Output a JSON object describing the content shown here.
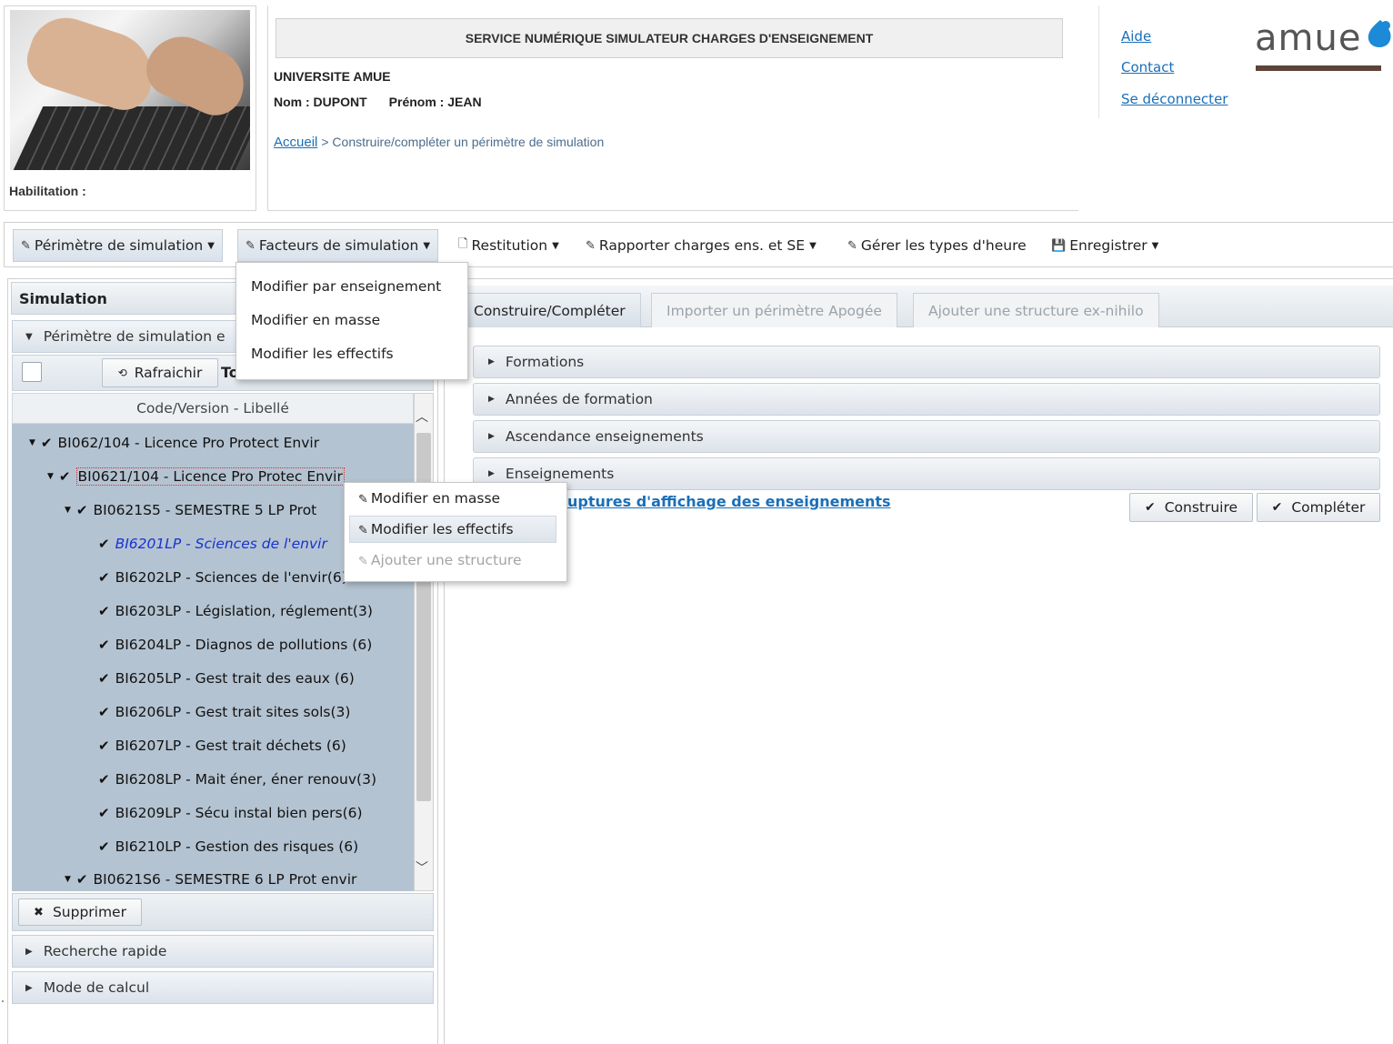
{
  "header": {
    "habilitation_label": "Habilitation :",
    "app_title": "SERVICE NUMÉRIQUE SIMULATEUR CHARGES D'ENSEIGNEMENT",
    "university": "UNIVERSITE AMUE",
    "nom": "Nom : DUPONT",
    "prenom": "Prénom : JEAN",
    "breadcrumb_home": "Accueil",
    "breadcrumb_current": "> Construire/compléter un périmètre de simulation",
    "links": {
      "aide": "Aide",
      "contact": "Contact",
      "deconnexion": "Se déconnecter"
    },
    "logo_text": "amue",
    "logo_color": "#1c8ad6"
  },
  "menubar": {
    "items": [
      {
        "label": "Périmètre de simulation",
        "icon": "pencil-icon"
      },
      {
        "label": "Facteurs de simulation",
        "icon": "pencil-icon"
      },
      {
        "label": "Restitution",
        "icon": "document-icon"
      },
      {
        "label": "Rapporter charges ens. et SE",
        "icon": "pencil-icon"
      },
      {
        "label": "Gérer les types d'heure",
        "icon": "pencil-icon"
      },
      {
        "label": "Enregistrer",
        "icon": "save-icon"
      }
    ]
  },
  "facteurs_dropdown": {
    "items": [
      "Modifier par enseignement",
      "Modifier en masse",
      "Modifier les effectifs"
    ]
  },
  "left_panel": {
    "title": "Simulation",
    "perimetre_header": "Périmètre de simulation e",
    "refresh_label": "Rafraichir",
    "tout_label": "To",
    "tree_column_header": "Code/Version - Libellé",
    "tree": [
      {
        "label": "BI062/104 - Licence Pro Protect Envir",
        "level": 0,
        "expandable": true
      },
      {
        "label": "BI0621/104 - Licence Pro Protec Envir",
        "level": 1,
        "expandable": true,
        "selected": true
      },
      {
        "label": "BI0621S5 - SEMESTRE 5 LP Prot",
        "level": 2,
        "expandable": true
      },
      {
        "label": "BI6201LP - Sciences de l'envir",
        "level": 3,
        "highlight": true
      },
      {
        "label": "BI6202LP - Sciences de l'envir",
        "level": 3
      },
      {
        "label": "BI6203LP - Législation, réglement(3)",
        "level": 3
      },
      {
        "label": "BI6204LP - Diagnos de pollutions (6)",
        "level": 3
      },
      {
        "label": "BI6205LP - Gest trait des eaux (6)",
        "level": 3
      },
      {
        "label": "BI6206LP - Gest trait sites sols(3)",
        "level": 3
      },
      {
        "label": "BI6207LP - Gest trait déchets (6)",
        "level": 3
      },
      {
        "label": "BI6208LP - Mait éner, éner renouv(3)",
        "level": 3
      },
      {
        "label": "BI6209LP - Sécu instal bien pers(6)",
        "level": 3
      },
      {
        "label": "BI6210LP - Gestion des risques (6)",
        "level": 3
      },
      {
        "label": "BI0621S6 - SEMESTRE 6 LP Prot envir",
        "level": 2,
        "expandable": true
      }
    ],
    "delete_label": "Supprimer",
    "recherche_label": "Recherche rapide",
    "mode_label": "Mode de calcul"
  },
  "context_menu": {
    "items": [
      {
        "label": "Modifier en masse",
        "enabled": true
      },
      {
        "label": "Modifier les effectifs",
        "enabled": true,
        "hovered": true
      },
      {
        "label": "Ajouter une structure",
        "enabled": false
      }
    ]
  },
  "right_panel": {
    "tabs": [
      {
        "label": "Construire/Compléter",
        "active": true
      },
      {
        "label": "Importer un périmètre Apogée",
        "active": false
      },
      {
        "label": "Ajouter une structure ex-nihilo",
        "active": false
      }
    ],
    "sections": [
      "Formations",
      "Années de formation",
      "Ascendance enseignements",
      "Enseignements"
    ],
    "ruptures_link": "uptures d'affichage des enseignements",
    "construire_label": "Construire",
    "completer_label": "Compléter"
  }
}
